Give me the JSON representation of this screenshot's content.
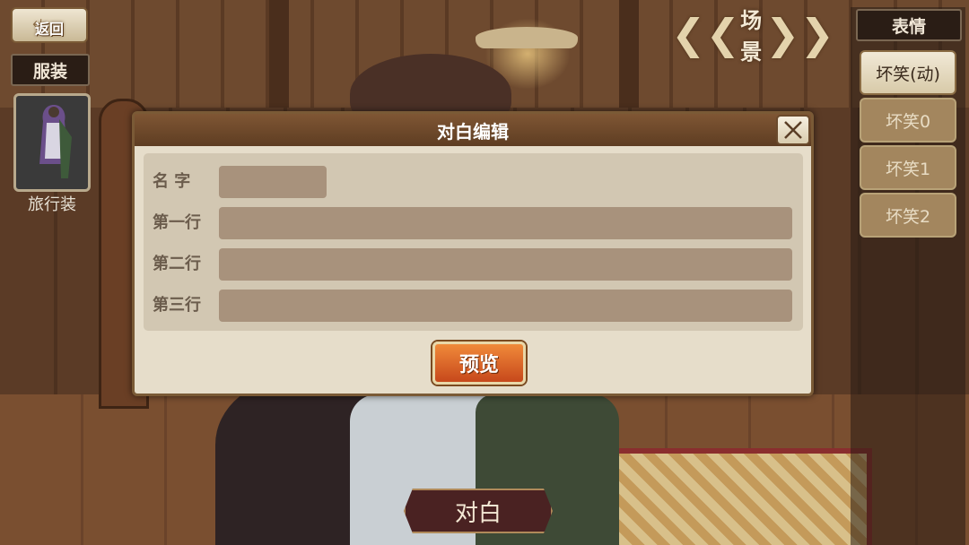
{
  "nav": {
    "back_label": "返回"
  },
  "outfit": {
    "section_label": "服装",
    "current_name": "旅行装"
  },
  "scene": {
    "label": "场景"
  },
  "expressions": {
    "section_label": "表情",
    "items": [
      {
        "label": "坏笑(动)",
        "active": true
      },
      {
        "label": "坏笑0",
        "active": false
      },
      {
        "label": "坏笑1",
        "active": false
      },
      {
        "label": "坏笑2",
        "active": false
      }
    ]
  },
  "dialog": {
    "title": "对白编辑",
    "fields": {
      "name": {
        "label": "名 字",
        "value": ""
      },
      "line1": {
        "label": "第一行",
        "value": ""
      },
      "line2": {
        "label": "第二行",
        "value": ""
      },
      "line3": {
        "label": "第三行",
        "value": ""
      }
    },
    "preview_label": "预览"
  },
  "bottom": {
    "dialogue_label": "对白"
  },
  "colors": {
    "accent_orange": "#e26a2c",
    "panel_brown": "#6a4527",
    "input_fill": "#a8927c",
    "dialog_bg": "#e6ddca"
  },
  "icons": [
    "back-arrow-icon",
    "chevron-left-icon",
    "chevron-right-icon",
    "close-icon"
  ]
}
